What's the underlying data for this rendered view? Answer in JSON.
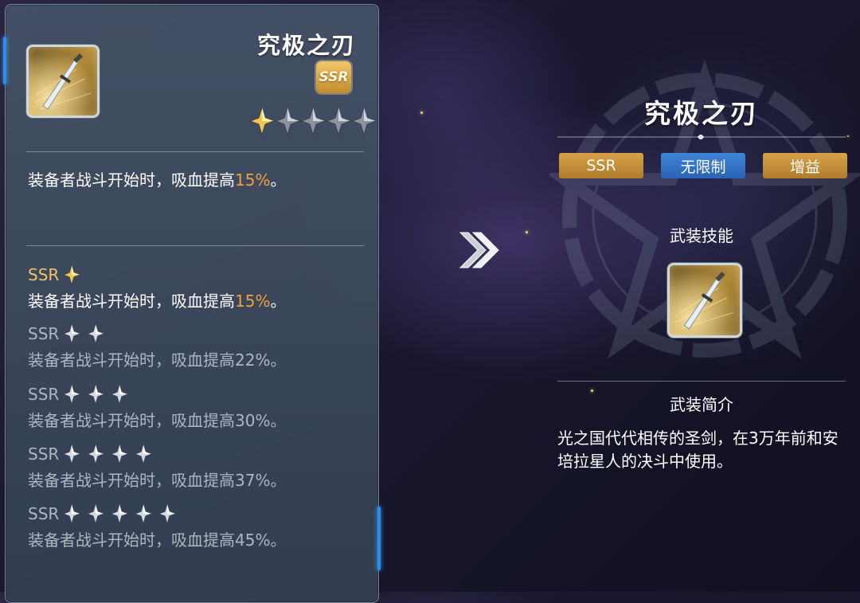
{
  "left_panel": {
    "title": "究极之刃",
    "rarity": "SSR",
    "star_count": 1,
    "star_max": 5,
    "description": {
      "prefix": "装备者战斗开始时，吸血提高",
      "value": "15%",
      "suffix": "。"
    },
    "levels": [
      {
        "label": "SSR",
        "stars": 1,
        "text_prefix": "装备者战斗开始时，吸血提高",
        "value": "15%",
        "suffix": "。",
        "active": true
      },
      {
        "label": "SSR",
        "stars": 2,
        "text_prefix": "装备者战斗开始时，吸血提高",
        "value": "22%",
        "suffix": "。",
        "active": false
      },
      {
        "label": "SSR",
        "stars": 3,
        "text_prefix": "装备者战斗开始时，吸血提高",
        "value": "30%",
        "suffix": "。",
        "active": false
      },
      {
        "label": "SSR",
        "stars": 4,
        "text_prefix": "装备者战斗开始时，吸血提高",
        "value": "37%",
        "suffix": "。",
        "active": false
      },
      {
        "label": "SSR",
        "stars": 5,
        "text_prefix": "装备者战斗开始时，吸血提高",
        "value": "45%",
        "suffix": "。",
        "active": false
      }
    ]
  },
  "right_panel": {
    "title": "究极之刃",
    "tags": [
      "SSR",
      "无限制",
      "增益"
    ],
    "skill_heading": "武装技能",
    "intro_heading": "武装简介",
    "intro_text": "光之国代代相传的圣剑，在3万年前和安培拉星人的决斗中使用。"
  },
  "colors": {
    "highlight": "#f0a040",
    "gold_tag": "#c8912f",
    "blue_tag": "#3677cc",
    "accent": "#2e8cf0"
  },
  "icons": [
    "sword-icon",
    "star-icon",
    "double-chevron-right-icon",
    "pentagram-emblem-icon"
  ]
}
